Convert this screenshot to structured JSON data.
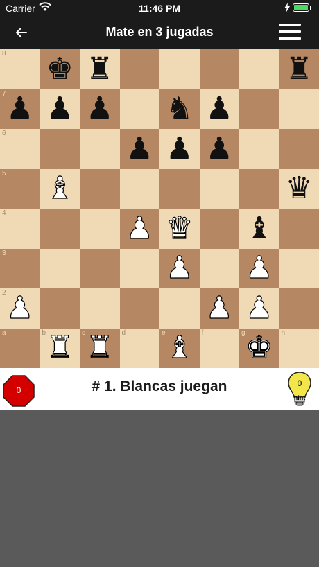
{
  "status": {
    "carrier": "Carrier",
    "time": "11:46 PM"
  },
  "nav": {
    "title": "Mate en 3 jugadas"
  },
  "board": {
    "rank_labels": [
      "8",
      "7",
      "6",
      "5",
      "4",
      "3",
      "2",
      ""
    ],
    "file_labels": [
      "a",
      "b",
      "c",
      "d",
      "e",
      "f",
      "g",
      "h"
    ],
    "pieces": [
      [
        null,
        "bK",
        "bR",
        null,
        null,
        null,
        null,
        "bR"
      ],
      [
        "bP",
        "bP",
        "bP",
        null,
        "bN",
        "bP",
        null,
        null
      ],
      [
        null,
        null,
        null,
        "bP",
        "bP",
        "bP",
        null,
        null
      ],
      [
        null,
        "wB",
        null,
        null,
        null,
        null,
        null,
        "bQ"
      ],
      [
        null,
        null,
        null,
        "wP",
        "wQ",
        null,
        "bB",
        null
      ],
      [
        null,
        null,
        null,
        null,
        "wP",
        null,
        "wP",
        null
      ],
      [
        "wP",
        null,
        null,
        null,
        null,
        "wP",
        "wP",
        null
      ],
      [
        null,
        "wR",
        "wR",
        null,
        "wB",
        null,
        "wK",
        null
      ]
    ]
  },
  "info": {
    "errors": "0",
    "message": "# 1. Blancas juegan",
    "hints": "0",
    "hint_label": "hint"
  },
  "colors": {
    "light_square": "#f0d9b5",
    "dark_square": "#b58863",
    "stop": "#d40000",
    "bulb": "#f3e64a"
  }
}
